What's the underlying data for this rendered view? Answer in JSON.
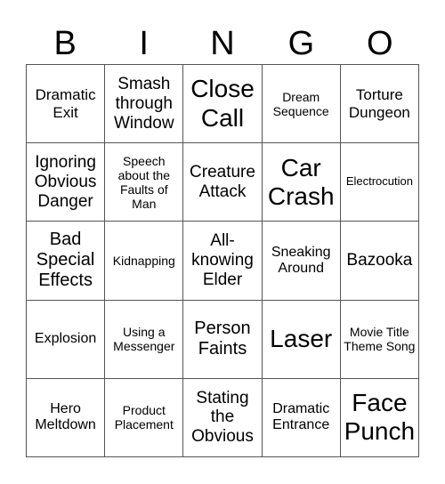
{
  "header": [
    "B",
    "I",
    "N",
    "G",
    "O"
  ],
  "cells": [
    [
      "Dramatic Exit",
      "Smash through Window",
      "Close Call",
      "Dream Sequence",
      "Torture Dungeon"
    ],
    [
      "Ignoring Obvious Danger",
      "Speech about the Faults of Man",
      "Creature Attack",
      "Car Crash",
      "Electrocution"
    ],
    [
      "Bad Special Effects",
      "Kidnapping",
      "All-knowing Elder",
      "Sneaking Around",
      "Bazooka"
    ],
    [
      "Explosion",
      "Using a Messenger",
      "Person Faints",
      "Laser",
      "Movie Title Theme Song"
    ],
    [
      "Hero Meltdown",
      "Product Placement",
      "Stating the Obvious",
      "Dramatic Entrance",
      "Face Punch"
    ]
  ]
}
